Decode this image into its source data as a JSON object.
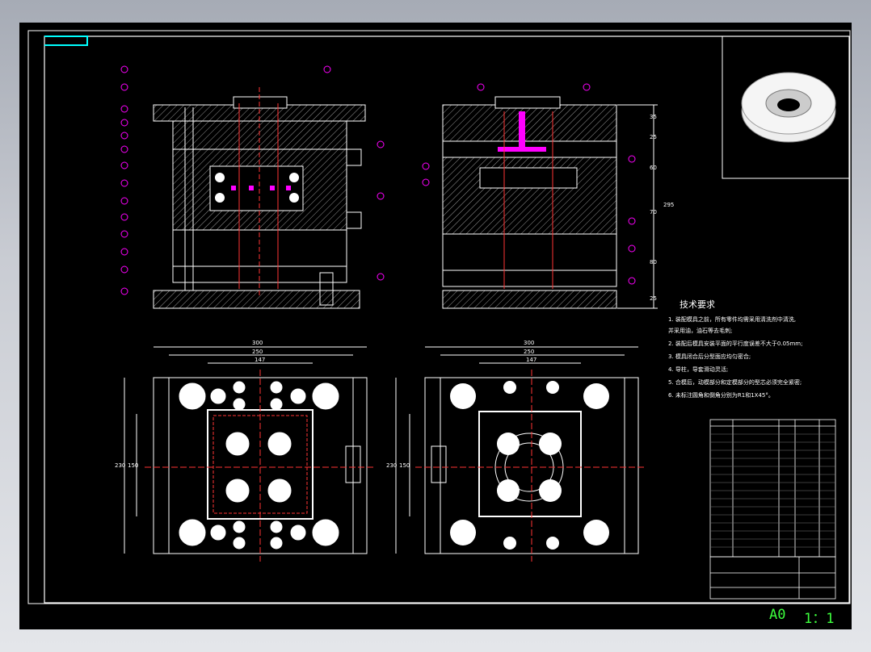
{
  "status": {
    "paper": "A0",
    "scale": "1：1"
  },
  "tech_requirements": {
    "title": "技术要求",
    "items": [
      "1. 装配模具之前，所有零件均需采用清洗剂中清洗,",
      "   并采用油，油石等去毛刺;",
      "2. 装配后模具安装平面的平行度误差不大于0.05mm;",
      "3. 模具闭合后分型面应均匀密合;",
      "4. 导柱，导套滑动灵活;",
      "5. 合模后，动模部分和定模部分的型芯必须完全紧密;",
      "6. 未标注圆角和倒角分别为R1和1X45°。"
    ]
  },
  "dimensions": {
    "right_side": [
      "35",
      "25",
      "60",
      "70",
      "80",
      "25",
      "295"
    ],
    "plan_left": [
      "300",
      "250",
      "147",
      "230",
      "150"
    ],
    "plan_right": [
      "300",
      "250",
      "147",
      "230",
      "150"
    ]
  },
  "colors": {
    "line": "#ffffff",
    "accent": "#ff00ff",
    "center": "#ff3333",
    "cyan": "#00ffff",
    "status": "#3dff3d"
  }
}
